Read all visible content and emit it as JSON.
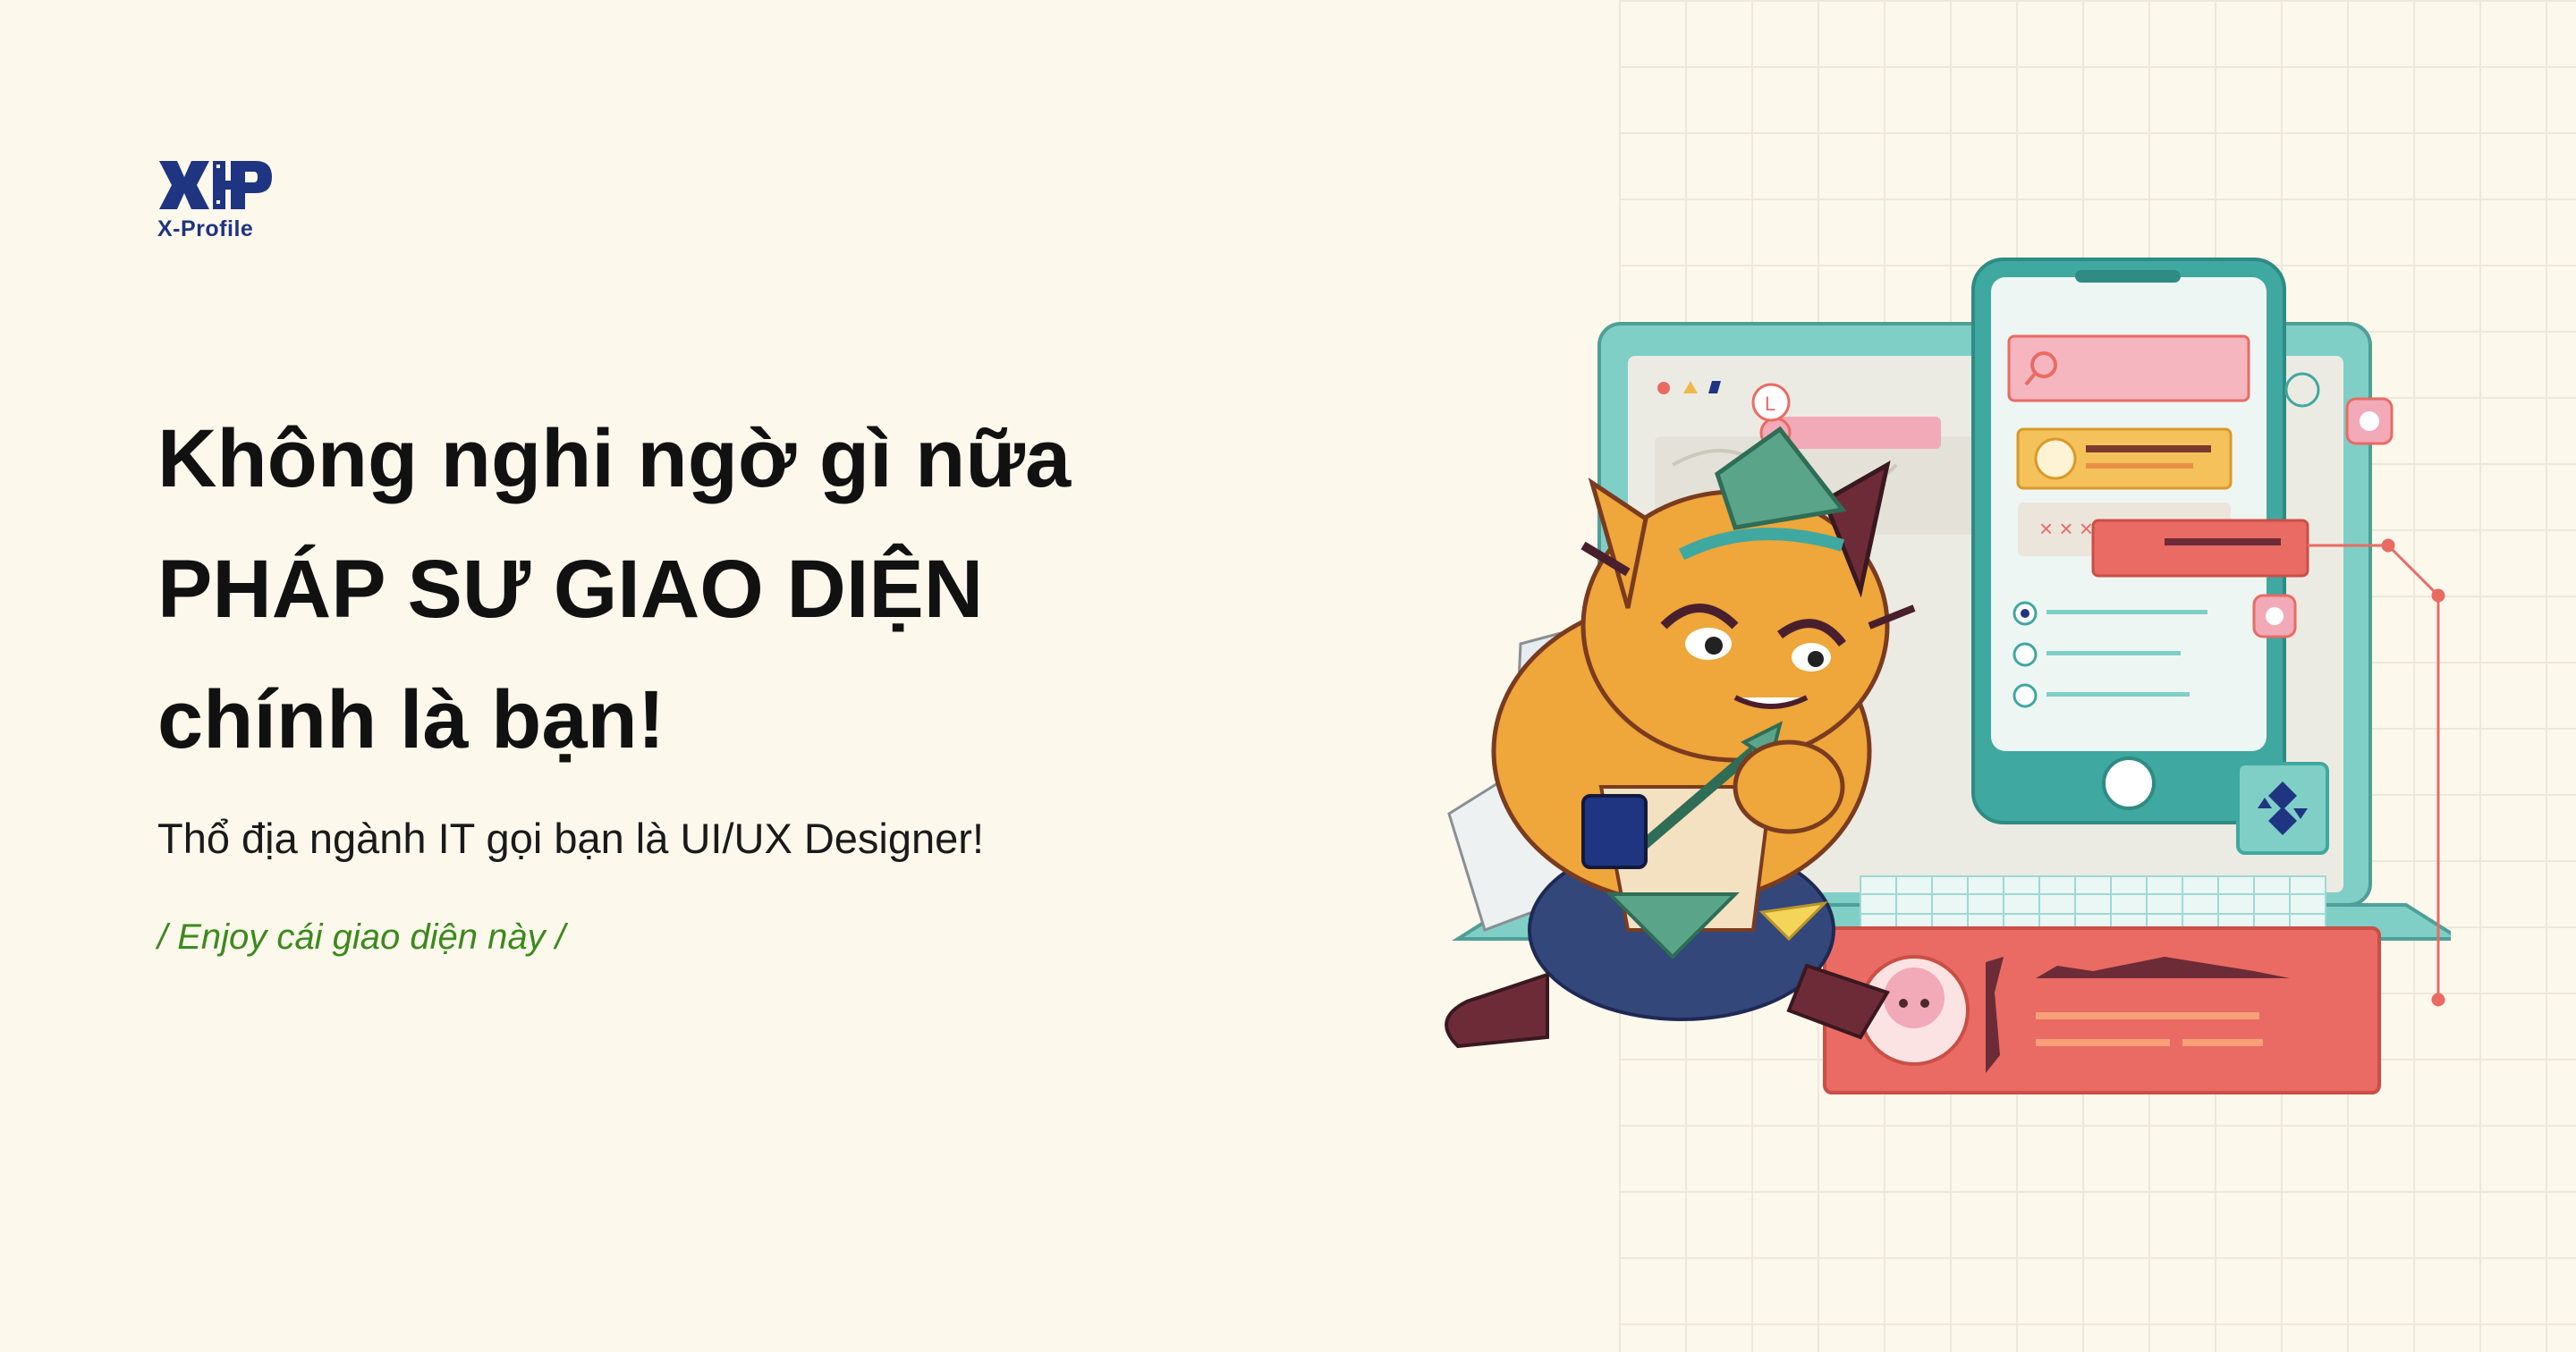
{
  "brand": {
    "name": "X-Profile",
    "colors": {
      "primary": "#1f3582",
      "background": "#fdf8ec",
      "accent_green": "#3a8a1c",
      "coral": "#e96b63",
      "teal": "#7fcfc6"
    }
  },
  "hero": {
    "headline": [
      "Không nghi ngờ gì nữa",
      "PHÁP SƯ GIAO DIỆN",
      "chính là bạn!"
    ],
    "subtitle": "Thổ địa ngành IT gọi bạn là UI/UX Designer!",
    "tagline": "/ Enjoy cái giao diện này /"
  },
  "illustration": {
    "description_icons": [
      "laptop-icon",
      "phone-icon",
      "cat-wizard-mascot",
      "chat-bubble-icon",
      "search-icon",
      "avatar-icon",
      "diamond-icon"
    ]
  }
}
